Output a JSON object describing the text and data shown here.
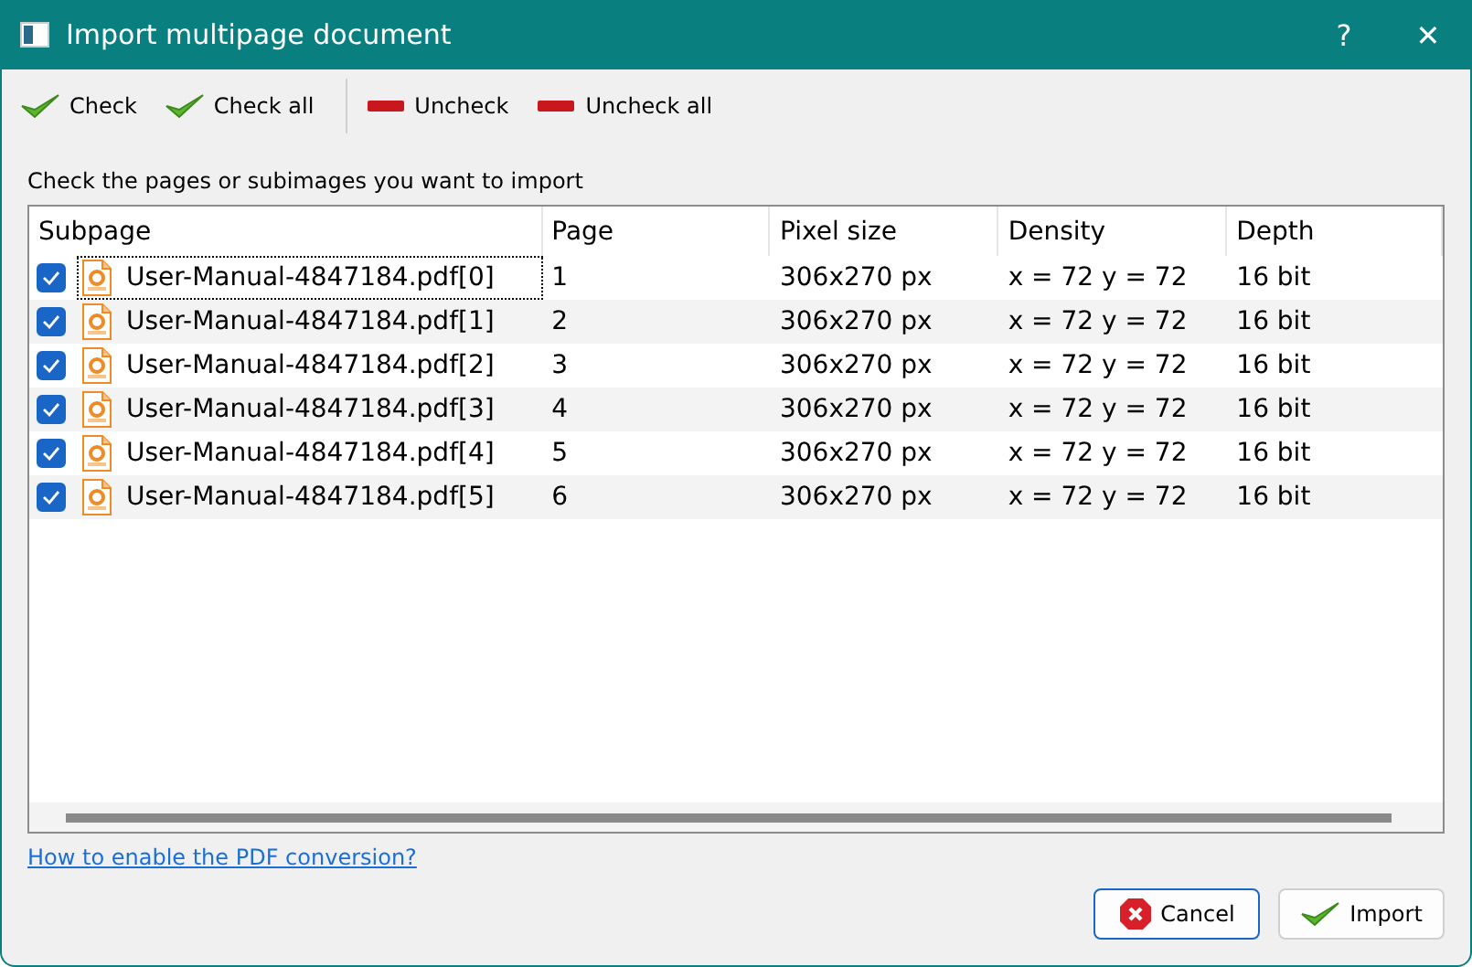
{
  "window": {
    "title": "Import multipage document",
    "help": "?",
    "close": "✕"
  },
  "toolbar": [
    {
      "label": "Check",
      "kind": "check"
    },
    {
      "label": "Check all",
      "kind": "check"
    },
    {
      "label": "Uncheck",
      "kind": "uncheck"
    },
    {
      "label": "Uncheck all",
      "kind": "uncheck"
    }
  ],
  "instruction": "Check the pages or subimages you want to import",
  "table": {
    "columns": [
      "Subpage",
      "Page",
      "Pixel size",
      "Density",
      "Depth"
    ],
    "rows": [
      {
        "checked": true,
        "focused": true,
        "cells": [
          "User-Manual-4847184.pdf[0]",
          "1",
          "306x270 px",
          "x = 72 y = 72",
          "16 bit"
        ]
      },
      {
        "checked": true,
        "focused": false,
        "cells": [
          "User-Manual-4847184.pdf[1]",
          "2",
          "306x270 px",
          "x = 72 y = 72",
          "16 bit"
        ]
      },
      {
        "checked": true,
        "focused": false,
        "cells": [
          "User-Manual-4847184.pdf[2]",
          "3",
          "306x270 px",
          "x = 72 y = 72",
          "16 bit"
        ]
      },
      {
        "checked": true,
        "focused": false,
        "cells": [
          "User-Manual-4847184.pdf[3]",
          "4",
          "306x270 px",
          "x = 72 y = 72",
          "16 bit"
        ]
      },
      {
        "checked": true,
        "focused": false,
        "cells": [
          "User-Manual-4847184.pdf[4]",
          "5",
          "306x270 px",
          "x = 72 y = 72",
          "16 bit"
        ]
      },
      {
        "checked": true,
        "focused": false,
        "cells": [
          "User-Manual-4847184.pdf[5]",
          "6",
          "306x270 px",
          "x = 72 y = 72",
          "16 bit"
        ]
      }
    ]
  },
  "link": "How to enable the PDF conversion?",
  "buttons": [
    {
      "label": "Cancel",
      "kind": "cancel"
    },
    {
      "label": "Import",
      "kind": "ok"
    }
  ]
}
